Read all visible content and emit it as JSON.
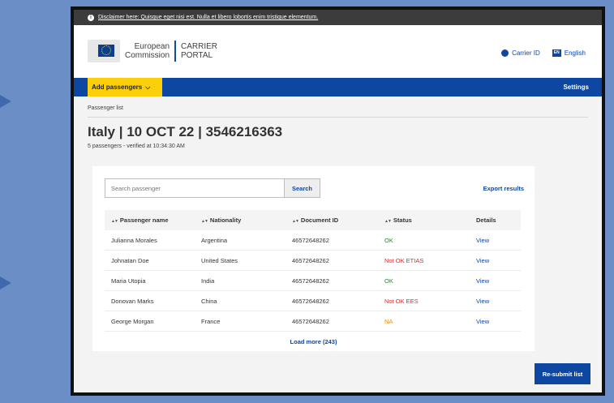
{
  "disclaimer": {
    "text": "Disclaimer here: Quisque eget nisi est. Nulla et libero lobortis enim tristique elementum."
  },
  "logo": {
    "org_line1": "European",
    "org_line2": "Commission",
    "portal_line1": "CARRIER",
    "portal_line2": "PORTAL"
  },
  "header": {
    "carrier_id": "Carrier ID",
    "lang_code": "EN",
    "language": "English"
  },
  "nav": {
    "add_passengers": "Add passengers",
    "settings": "Settings"
  },
  "breadcrumb": "Passenger list",
  "title": "Italy | 10 OCT 22 | 3546216363",
  "subtitle": "5 passengers - verified at 10:34:30 AM",
  "search": {
    "placeholder": "Search passenger",
    "button": "Search"
  },
  "export_label": "Export results",
  "table": {
    "sort_glyph": "▲▼",
    "headers": {
      "name": "Passenger name",
      "nationality": "Nationality",
      "document": "Document ID",
      "status": "Status",
      "details": "Details"
    },
    "rows": [
      {
        "name": "Julianna Morales",
        "nationality": "Argentina",
        "document": "46572648262",
        "status": "OK",
        "status_color": "#2e7d32",
        "details": "View"
      },
      {
        "name": "Johnatan Doe",
        "nationality": "United States",
        "document": "46572648262",
        "status": "Not OK ETIAS",
        "status_color": "#d32f2f",
        "details": "View"
      },
      {
        "name": "Maria Utopia",
        "nationality": "India",
        "document": "46572648262",
        "status": "OK",
        "status_color": "#2e7d32",
        "details": "View"
      },
      {
        "name": "Donovan Marks",
        "nationality": "China",
        "document": "46572648262",
        "status": "Not OK EES",
        "status_color": "#d32f2f",
        "details": "View"
      },
      {
        "name": "George Morgan",
        "nationality": "France",
        "document": "46572648262",
        "status": "NA",
        "status_color": "#ef8c00",
        "details": "View"
      }
    ]
  },
  "load_more": "Load more (243)",
  "resubmit": "Re-submit list",
  "colors": {
    "primary": "#0e47a1",
    "accent": "#fbd00b",
    "ok": "#2e7d32",
    "error": "#d32f2f",
    "warning": "#ef8c00"
  }
}
